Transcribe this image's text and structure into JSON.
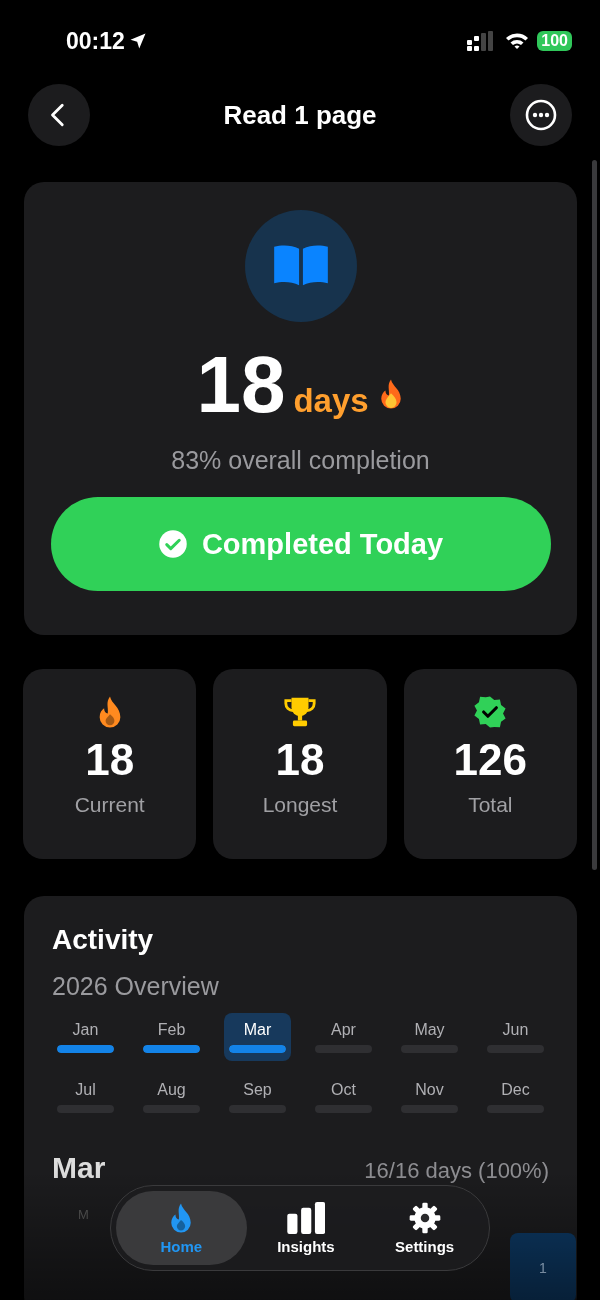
{
  "status_bar": {
    "time": "00:12",
    "battery": "100"
  },
  "header": {
    "title": "Read 1 page"
  },
  "streak": {
    "count": "18",
    "unit": "days",
    "completion": "83% overall completion",
    "button": {
      "label": "Completed Today",
      "completed": true
    }
  },
  "stats": [
    {
      "kind": "flame",
      "value": "18",
      "label": "Current"
    },
    {
      "kind": "trophy",
      "value": "18",
      "label": "Longest"
    },
    {
      "kind": "badge",
      "value": "126",
      "label": "Total"
    }
  ],
  "activity": {
    "title": "Activity",
    "subtitle": "2026 Overview",
    "months": [
      {
        "label": "Jan",
        "level": 1,
        "selected": false
      },
      {
        "label": "Feb",
        "level": 1,
        "selected": false
      },
      {
        "label": "Mar",
        "level": 1,
        "selected": true
      },
      {
        "label": "Apr",
        "level": 0,
        "selected": false
      },
      {
        "label": "May",
        "level": 0,
        "selected": false
      },
      {
        "label": "Jun",
        "level": 0,
        "selected": false
      },
      {
        "label": "Jul",
        "level": 0,
        "selected": false
      },
      {
        "label": "Aug",
        "level": 0,
        "selected": false
      },
      {
        "label": "Sep",
        "level": 0,
        "selected": false
      },
      {
        "label": "Oct",
        "level": 0,
        "selected": false
      },
      {
        "label": "Nov",
        "level": 0,
        "selected": false
      },
      {
        "label": "Dec",
        "level": 0,
        "selected": false
      }
    ],
    "month_title": "Mar",
    "month_summary": "16/16 days (100%)",
    "weekday": "M",
    "day": {
      "label": "1",
      "done": true
    }
  },
  "tab_bar": [
    {
      "kind": "flame",
      "label": "Home",
      "selected": true
    },
    {
      "kind": "bars",
      "label": "Insights",
      "selected": false
    },
    {
      "kind": "gear",
      "label": "Settings",
      "selected": false
    }
  ]
}
